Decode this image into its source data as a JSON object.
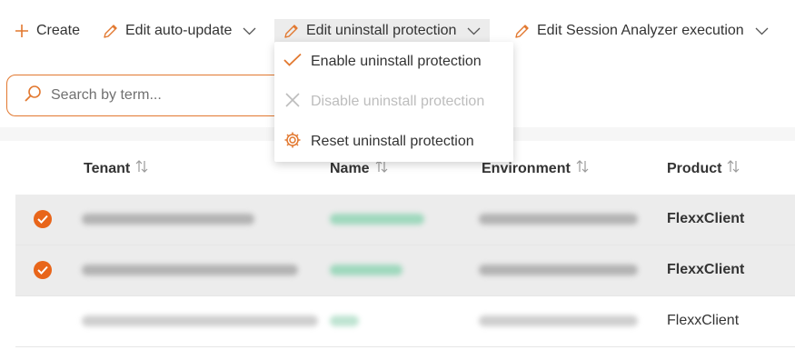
{
  "toolbar": {
    "create_label": "Create",
    "auto_update_label": "Edit auto-update",
    "uninstall_label": "Edit uninstall protection",
    "session_label": "Edit Session Analyzer execution"
  },
  "search": {
    "placeholder": "Search by term..."
  },
  "dropdown": {
    "items": [
      {
        "label": "Enable uninstall protection",
        "icon": "check-icon",
        "disabled": false
      },
      {
        "label": "Disable uninstall protection",
        "icon": "close-icon",
        "disabled": true
      },
      {
        "label": "Reset uninstall protection",
        "icon": "gear-icon",
        "disabled": false
      }
    ]
  },
  "table": {
    "columns": [
      "Tenant",
      "Name",
      "Environment",
      "Product"
    ],
    "rows": [
      {
        "selected": true,
        "product": "FlexxClient"
      },
      {
        "selected": true,
        "product": "FlexxClient"
      },
      {
        "selected": false,
        "product": "FlexxClient"
      }
    ]
  },
  "colors": {
    "accent": "#e8651a",
    "selected_row": "#ececec",
    "name_link": "#2e9a6a"
  }
}
